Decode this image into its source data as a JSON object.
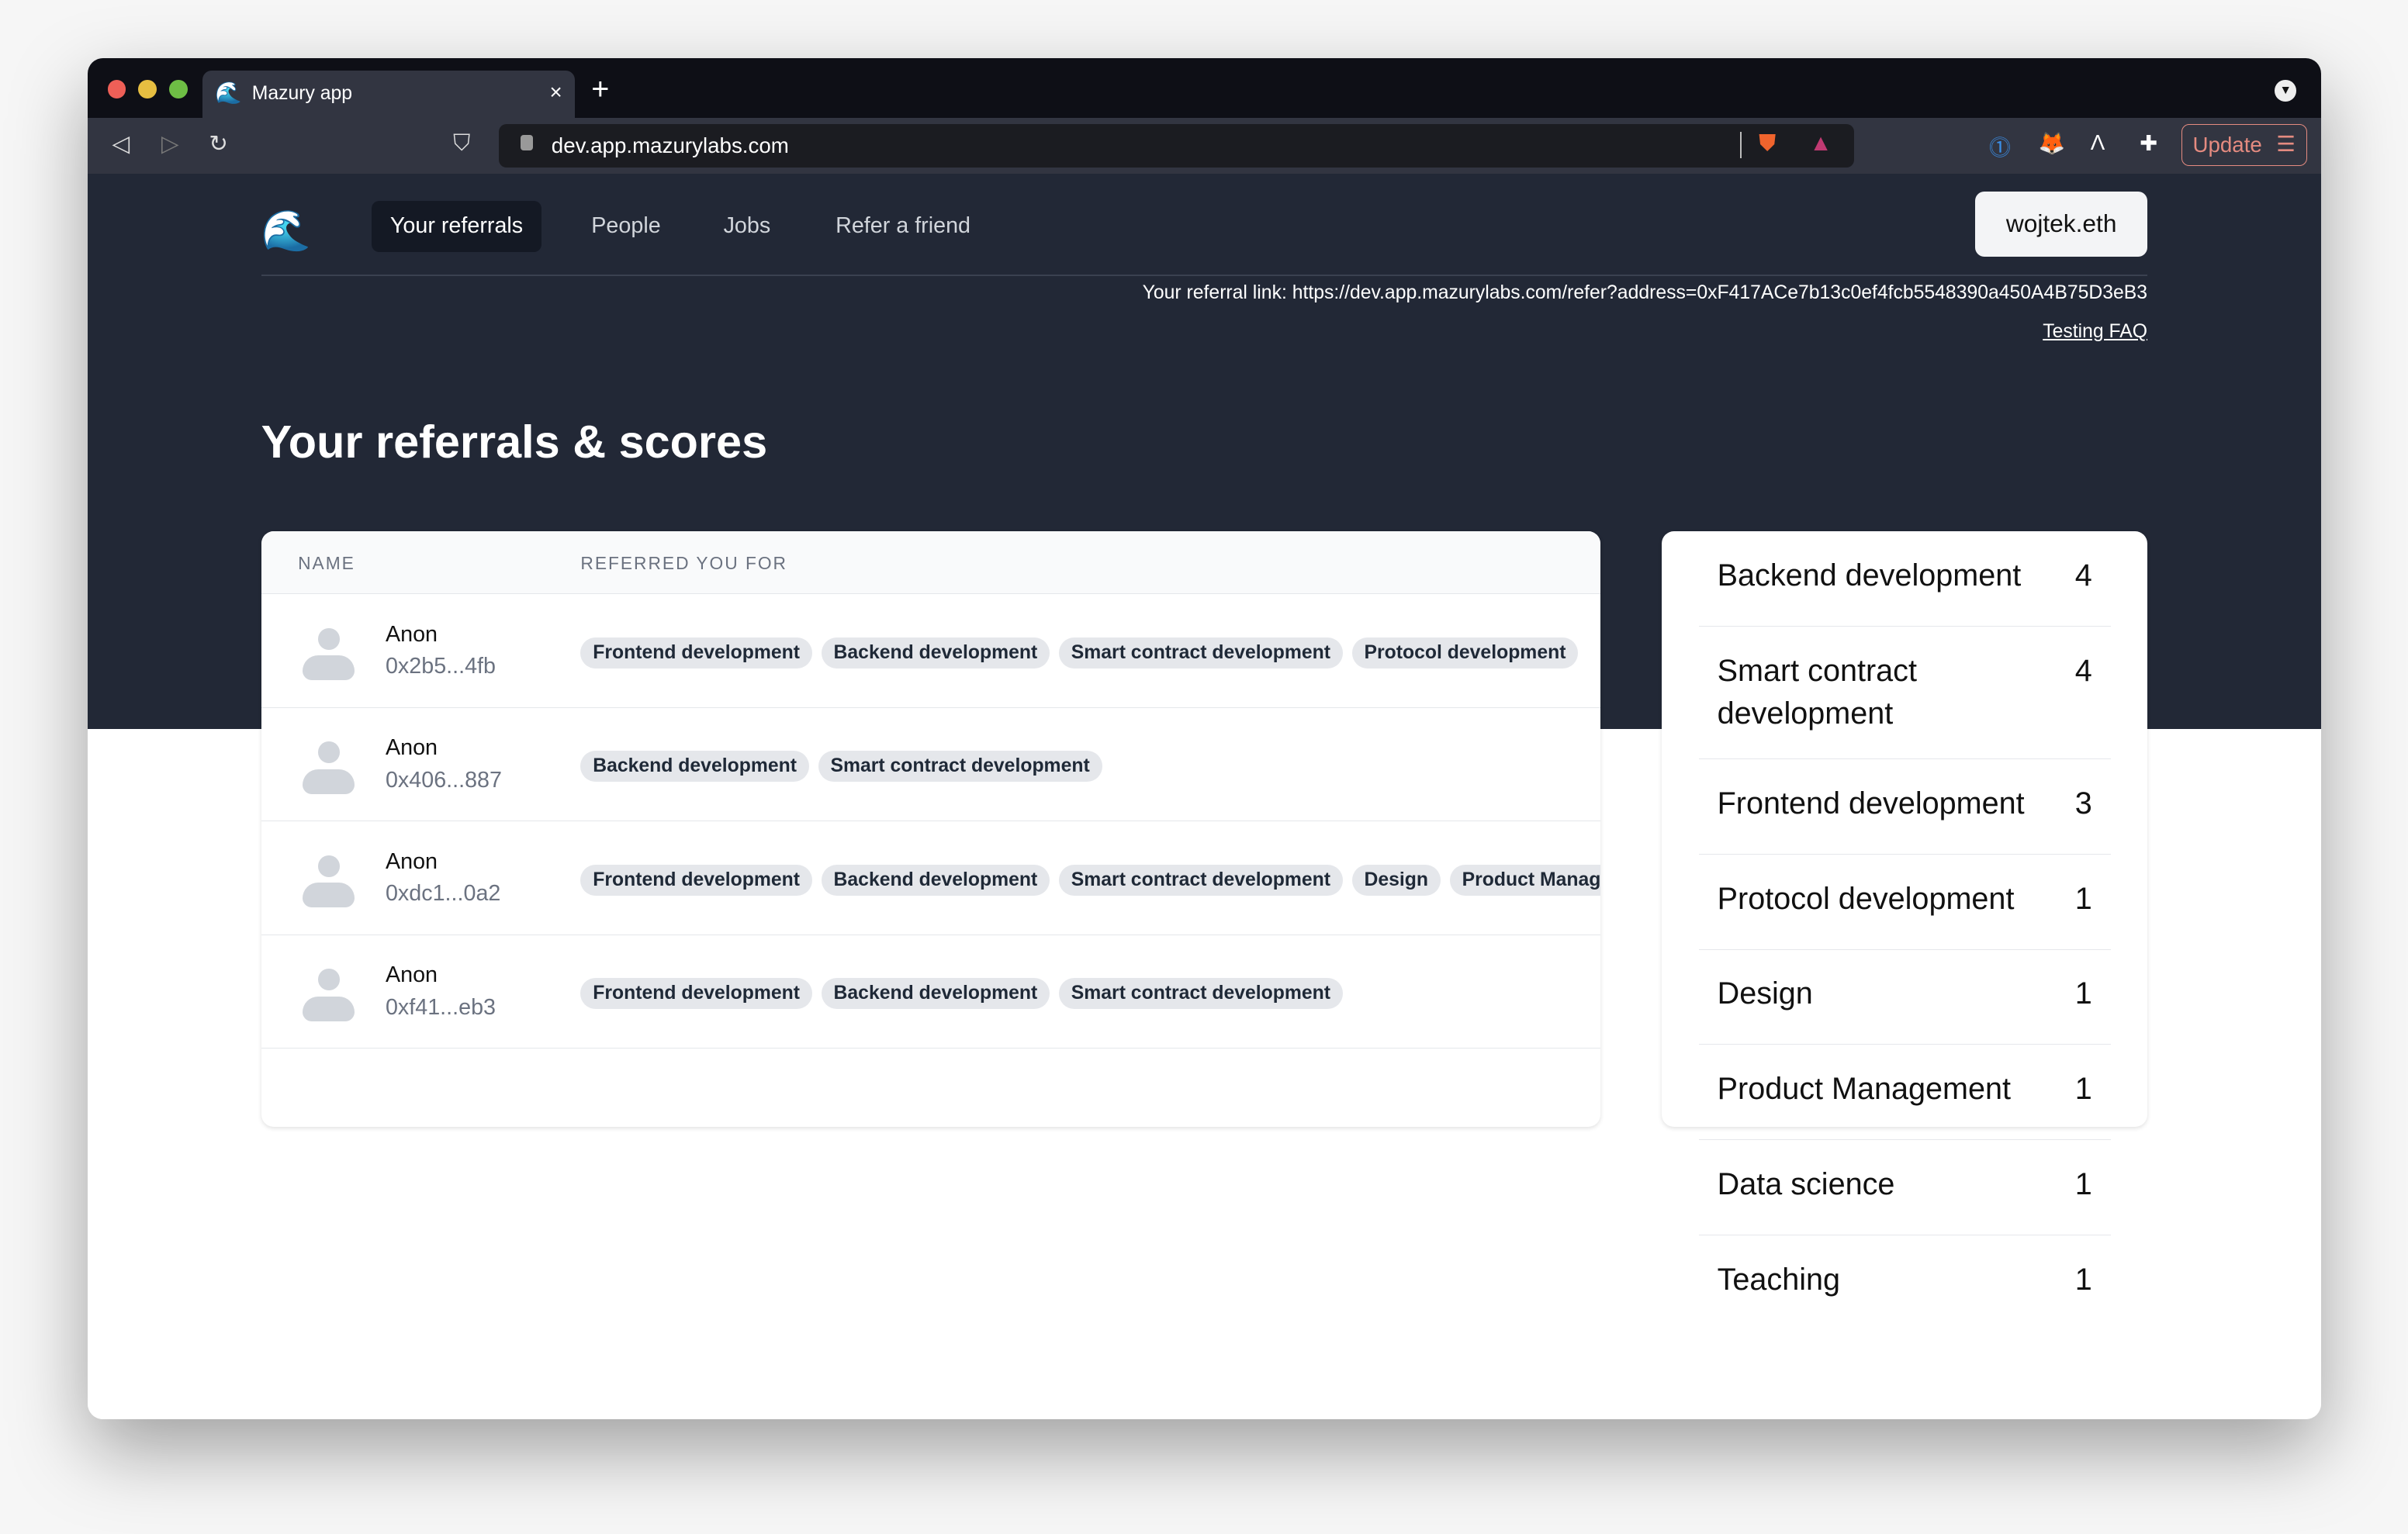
{
  "browser": {
    "tab_title": "Mazury app",
    "url": "dev.app.mazurylabs.com",
    "update_label": "Update"
  },
  "nav": {
    "items": [
      "Your referrals",
      "People",
      "Jobs",
      "Refer a friend"
    ],
    "user": "wojtek.eth"
  },
  "referral_link": "Your referral link: https://dev.app.mazurylabs.com/refer?address=0xF417ACe7b13c0ef4fcb5548390a450A4B75D3eB3",
  "faq": "Testing FAQ",
  "title": "Your referrals & scores",
  "table": {
    "headers": [
      "NAME",
      "REFERRED YOU FOR"
    ],
    "rows": [
      {
        "name": "Anon",
        "address": "0x2b5...4fb",
        "tags": [
          "Frontend development",
          "Backend development",
          "Smart contract development",
          "Protocol development"
        ]
      },
      {
        "name": "Anon",
        "address": "0x406...887",
        "tags": [
          "Backend development",
          "Smart contract development"
        ]
      },
      {
        "name": "Anon",
        "address": "0xdc1...0a2",
        "tags": [
          "Frontend development",
          "Backend development",
          "Smart contract development",
          "Design",
          "Product Management"
        ]
      },
      {
        "name": "Anon",
        "address": "0xf41...eb3",
        "tags": [
          "Frontend development",
          "Backend development",
          "Smart contract development"
        ]
      }
    ]
  },
  "scores": [
    {
      "label": "Backend development",
      "count": "4"
    },
    {
      "label": "Smart contract development",
      "count": "4"
    },
    {
      "label": "Frontend development",
      "count": "3"
    },
    {
      "label": "Protocol development",
      "count": "1"
    },
    {
      "label": "Design",
      "count": "1"
    },
    {
      "label": "Product Management",
      "count": "1"
    },
    {
      "label": "Data science",
      "count": "1"
    },
    {
      "label": "Teaching",
      "count": "1"
    }
  ]
}
